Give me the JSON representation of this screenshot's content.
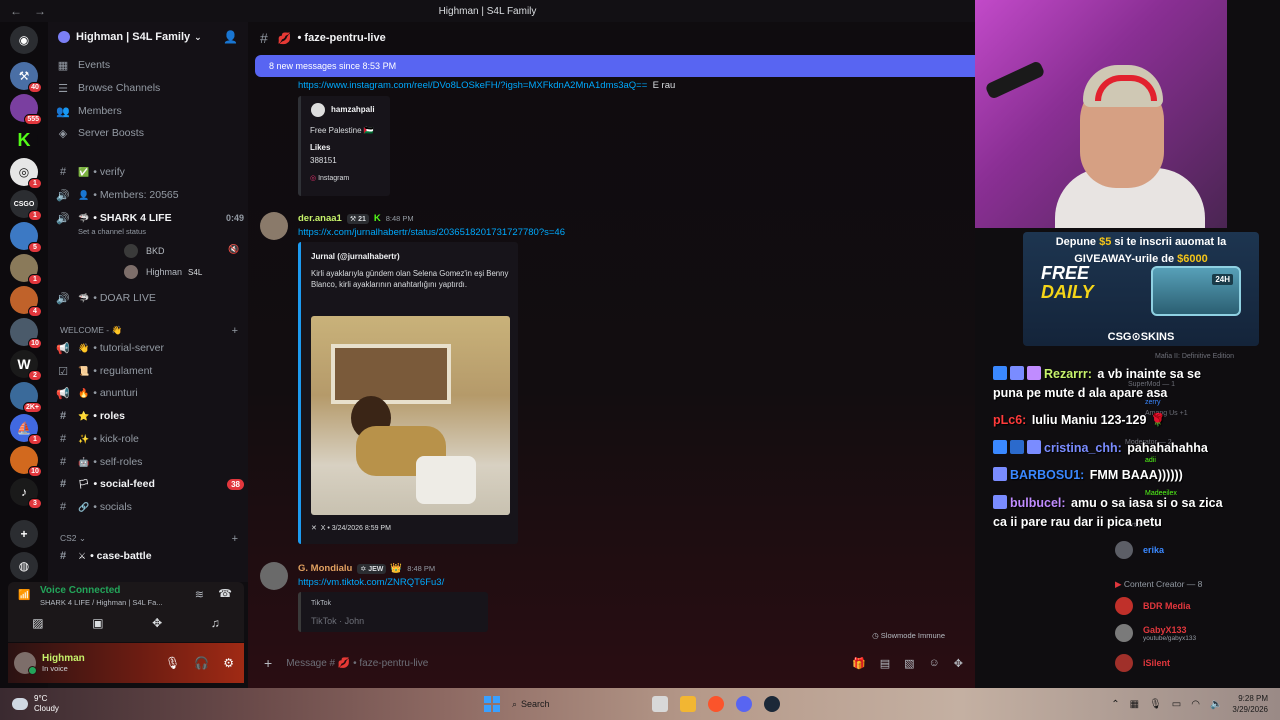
{
  "window": {
    "title": "Highman | S4L Family"
  },
  "rail": {
    "servers": [
      {
        "icon": "discord-home-icon",
        "badge": ""
      },
      {
        "icon": "server-1",
        "badge": "40"
      },
      {
        "icon": "server-2",
        "badge": "555"
      },
      {
        "icon": "server-kick",
        "badge": ""
      },
      {
        "icon": "server-4",
        "badge": "1"
      },
      {
        "icon": "server-csgo",
        "badge": "1"
      },
      {
        "icon": "server-6",
        "badge": "5"
      },
      {
        "icon": "server-7",
        "badge": "1"
      },
      {
        "icon": "server-8",
        "badge": "4"
      },
      {
        "icon": "server-9",
        "badge": "10"
      },
      {
        "icon": "server-w",
        "badge": "2"
      },
      {
        "icon": "server-11",
        "badge": "2K+"
      },
      {
        "icon": "server-12",
        "badge": "1"
      },
      {
        "icon": "server-13",
        "badge": "10"
      },
      {
        "icon": "server-14",
        "badge": "3"
      },
      {
        "icon": "add-server-icon",
        "badge": ""
      },
      {
        "icon": "discover-icon",
        "badge": ""
      }
    ]
  },
  "sidebar": {
    "server_name": "Highman | S4L Family",
    "events": "Events",
    "browse": "Browse Channels",
    "members": "Members",
    "boosts": "Server Boosts",
    "verify": "verify",
    "members_count": "Members: 20565",
    "voice_channel": "SHARK 4 LIFE",
    "voice_time": "0:49",
    "channel_status": "Set a channel status",
    "voice_users": [
      "BKD",
      "Highman"
    ],
    "voice_user_tag": "S4L",
    "doar_live": "DOAR LIVE",
    "cat_welcome": "WELCOME -",
    "channels": [
      {
        "name": "tutorial-server",
        "bold": false
      },
      {
        "name": "regulament",
        "bold": false
      },
      {
        "name": "anunturi",
        "bold": false
      },
      {
        "name": "roles",
        "bold": true
      },
      {
        "name": "kick-role",
        "bold": false
      },
      {
        "name": "self-roles",
        "bold": false
      },
      {
        "name": "social-feed",
        "bold": true,
        "count": "38"
      },
      {
        "name": "socials",
        "bold": false
      }
    ],
    "cat_cs2": "CS2",
    "case_battle": "case-battle"
  },
  "voice": {
    "status": "Voice Connected",
    "where": "SHARK 4 LIFE / Highman | S4L Fa..."
  },
  "user": {
    "name": "Highman",
    "status": "In voice"
  },
  "chat": {
    "channel": "faze-pentru-live",
    "new_messages": "8 new messages since 8:53 PM",
    "msg1_link": "https://www.instagram.com/reel/DVo8LOSkeFH/?igsh=MXFkdnA2MnA1dms3aQ==",
    "msg1_text": "E rau",
    "ig_embed": {
      "author": "hamzahpali",
      "desc": "Free Palestine 🇵🇸",
      "likes_label": "Likes",
      "likes": "388151",
      "provider": "Instagram"
    },
    "msg2": {
      "author": "der.anaa1",
      "tag": "21",
      "time": "8:48 PM",
      "link": "https://x.com/jurnalhabertr/status/2036518201731727780?s=46"
    },
    "tw_embed": {
      "author": "Jurnal (@jurnalhabertr)",
      "text": "Kirli ayaklarıyla gündem olan Selena Gomez'in eşi Benny Blanco, kirli ayaklarının anahtarlığını yaptırdı.",
      "footer": "X • 3/24/2026 8:59 PM"
    },
    "msg3": {
      "author": "G. Mondialu",
      "tag": "JEW",
      "time": "8:48 PM",
      "link": "https://vm.tiktok.com/ZNRQT6Fu3/"
    },
    "tt_embed": {
      "provider": "TikTok",
      "title": "TikTok · John"
    },
    "slowmode": "Slowmode Immune",
    "placeholder_prefix": "Message #",
    "placeholder_channel": "faze-pentru-live"
  },
  "stream": {
    "ad": {
      "line1_a": "Depune ",
      "line1_amt": "$5",
      "line1_b": " si te inscrii auomat la",
      "line2_a": "GIVEAWAY-urile de ",
      "line2_amt": "$6000",
      "free": "FREE",
      "daily": "DAILY",
      "case_label": "24H",
      "brand": "CSG⊙SKINS"
    },
    "chat": [
      {
        "user": "Rezarrr:",
        "color": "#c6f16b",
        "text": "a vb inainte sa se"
      },
      {
        "user": "",
        "color": "#ffffff",
        "text": "puna pe mute d ala apare asa"
      },
      {
        "user": "pLc6:",
        "color": "#ff3b3b",
        "text": "Iuliu Maniu 123-129"
      },
      {
        "user": "cristina_chh:",
        "color": "#7a8cff",
        "text": "pahahahahha"
      },
      {
        "user": "BARBOSU1:",
        "color": "#3a88ff",
        "text": "FMM BAAA))))))"
      },
      {
        "user": "bulbucel:",
        "color": "#c08cff",
        "text": "amu o sa iasa si o sa zica"
      },
      {
        "user": "",
        "color": "#ffffff",
        "text": "ca ii pare rau dar ii pica netu"
      }
    ],
    "faint": [
      "Mafia II: Definitive Edition",
      "SuperMod — 1",
      "zerry",
      "Among Us +1",
      "Moderator — 2",
      "adii",
      "Madeeilex",
      "Artist — 1"
    ],
    "members": [
      {
        "name": "erika",
        "color": "#3a88ff",
        "sub": ""
      },
      {
        "name": "BDR Media",
        "color": "#e2373d",
        "sub": ""
      },
      {
        "name": "GabyX133",
        "color": "#e2373d",
        "sub": "youtube/gabyx133"
      },
      {
        "name": "iSilent",
        "color": "#e2373d",
        "sub": ""
      }
    ],
    "section_creator": "Content Creator — 8"
  },
  "taskbar": {
    "temp": "9°C",
    "weather": "Cloudy",
    "search": "Search",
    "time": "9:28 PM",
    "date": "3/29/2026"
  }
}
